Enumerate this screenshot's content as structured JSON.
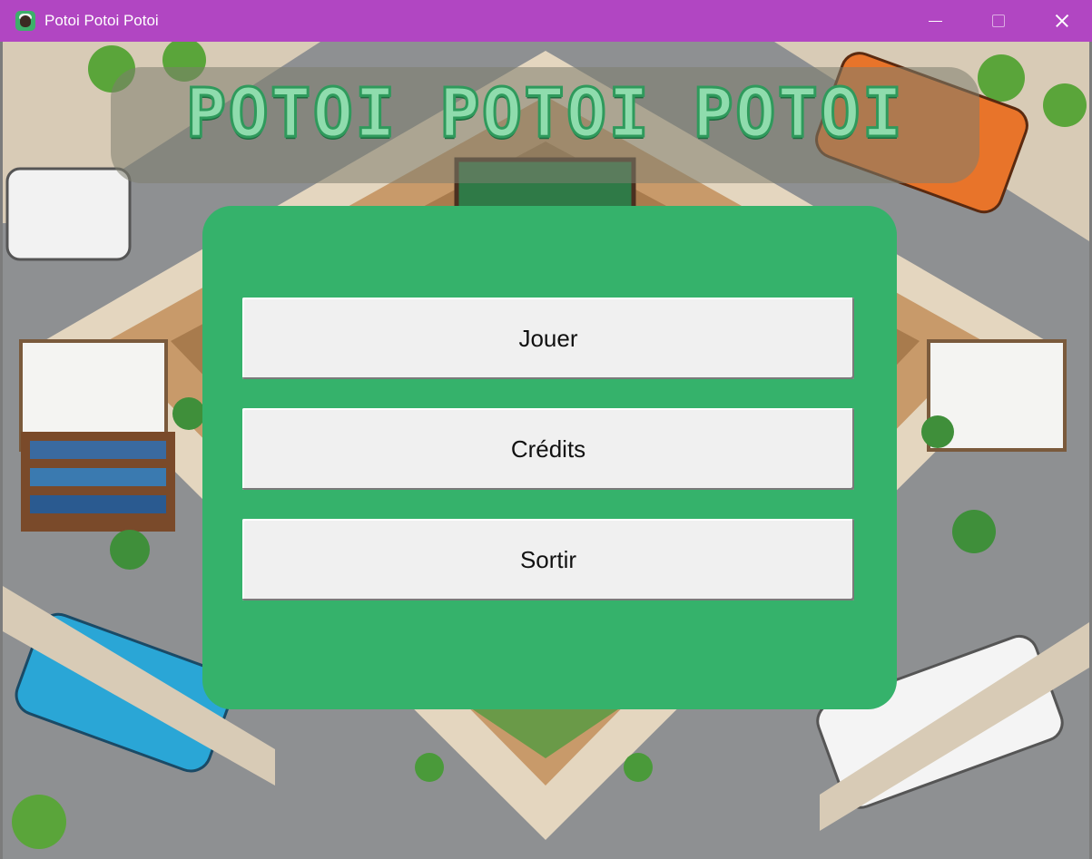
{
  "window": {
    "title": "Potoi Potoi Potoi",
    "icon": "app-icon"
  },
  "game": {
    "title": "POTOI POTOI POTOI"
  },
  "menu": {
    "play_label": "Jouer",
    "credits_label": "Crédits",
    "quit_label": "Sortir"
  },
  "colors": {
    "titlebar": "#b146c2",
    "panel": "#35b26b",
    "button": "#f0f0f0",
    "title_text": "#8fdcad"
  }
}
